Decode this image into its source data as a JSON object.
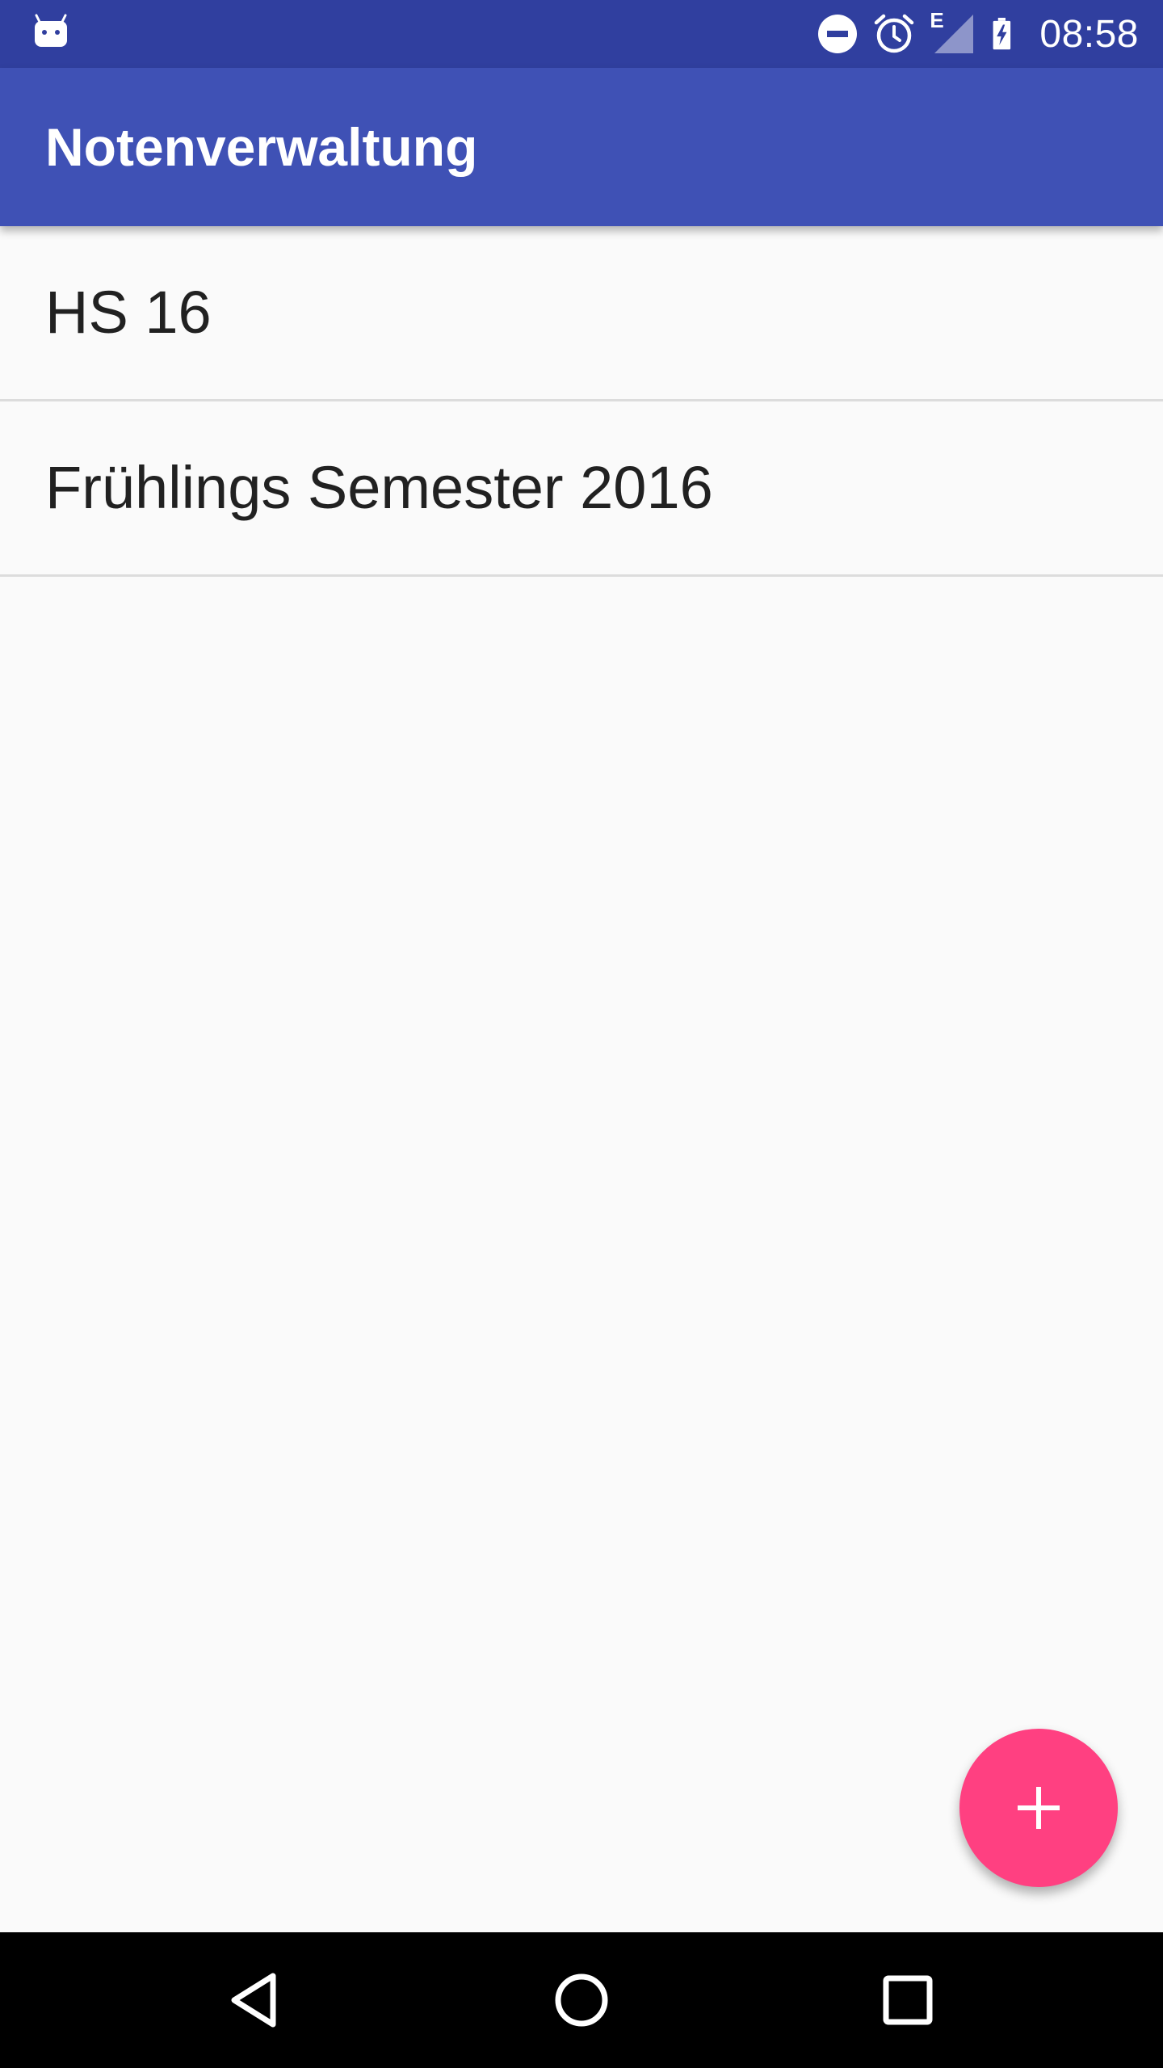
{
  "status_bar": {
    "time": "08:58",
    "network_label": "E",
    "icons": [
      "android-notification-icon",
      "do-not-disturb-icon",
      "alarm-icon",
      "signal-icon",
      "battery-charging-icon"
    ]
  },
  "app_bar": {
    "title": "Notenverwaltung"
  },
  "list": {
    "items": [
      {
        "label": "HS 16"
      },
      {
        "label": "Frühlings Semester 2016"
      }
    ]
  },
  "fab": {
    "icon": "plus-icon"
  },
  "nav_bar": {
    "icons": [
      "back-icon",
      "home-icon",
      "recents-icon"
    ]
  },
  "colors": {
    "status_bar": "#303f9f",
    "app_bar": "#3f51b5",
    "accent": "#ff4081",
    "background": "#fafafa",
    "text": "#212121"
  }
}
